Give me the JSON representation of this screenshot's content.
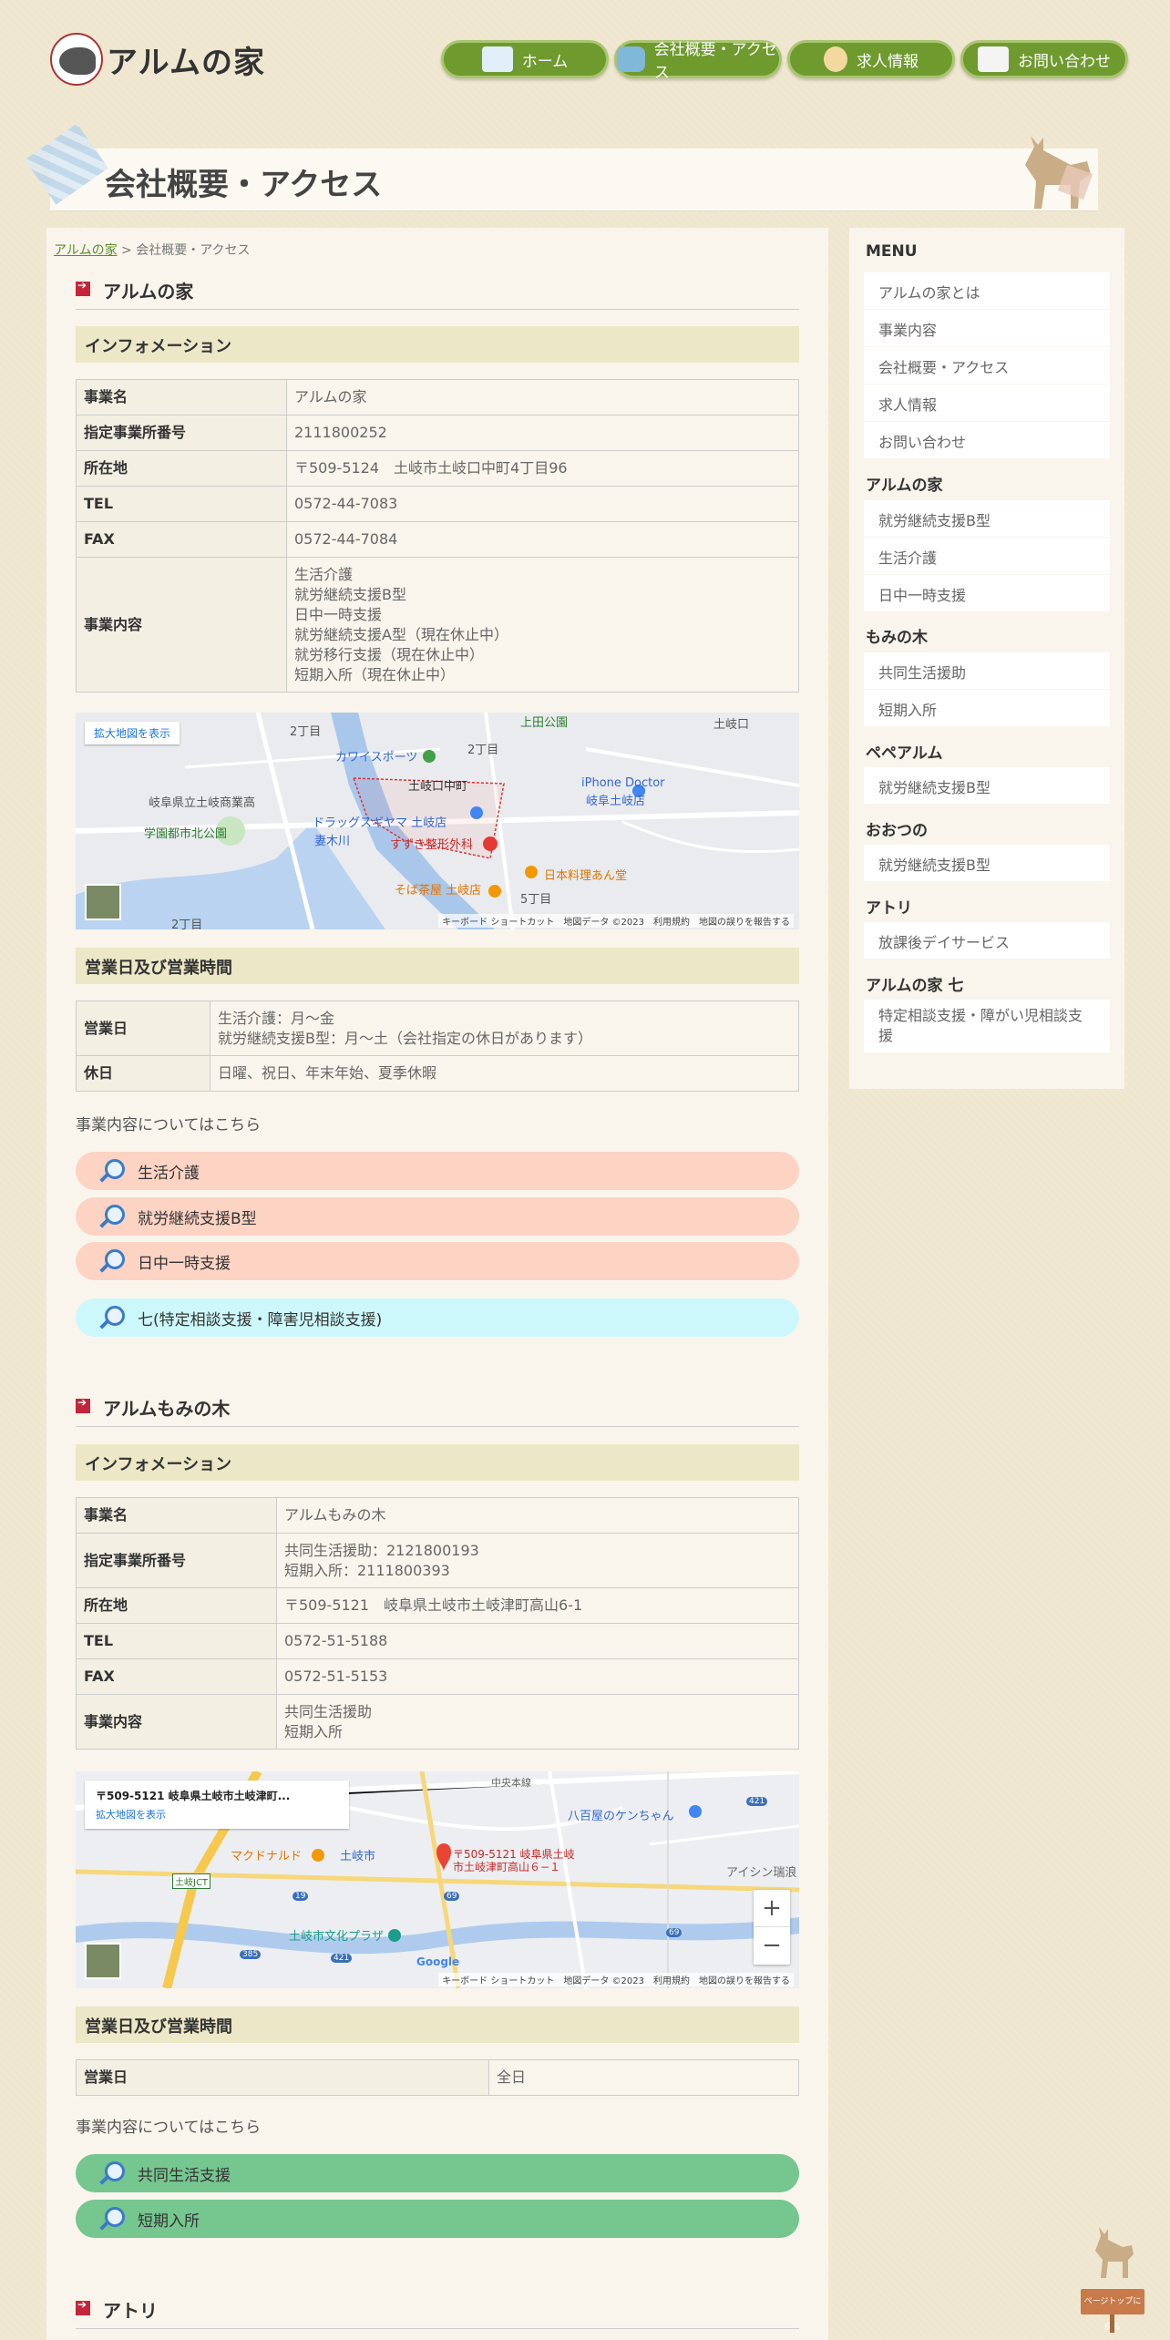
{
  "header": {
    "logo_text": "アルムの家",
    "nav": [
      {
        "label": "ホーム",
        "icon": "house-icon"
      },
      {
        "label": "会社概要・アクセス",
        "icon": "bus-icon"
      },
      {
        "label": "求人情報",
        "icon": "face-icon"
      },
      {
        "label": "お問い合わせ",
        "icon": "mail-icon"
      }
    ]
  },
  "page_title": "会社概要・アクセス",
  "breadcrumb": {
    "home": "アルムの家",
    "sep": ">",
    "current": "会社概要・アクセス"
  },
  "sections": {
    "arumu": {
      "title": "アルムの家",
      "info_title": "インフォメーション",
      "rows": [
        {
          "k": "事業名",
          "v": "アルムの家"
        },
        {
          "k": "指定事業所番号",
          "v": "2111800252"
        },
        {
          "k": "所在地",
          "v": "〒509-5124　土岐市土岐口中町4丁目96"
        },
        {
          "k": "TEL",
          "v": "0572-44-7083"
        },
        {
          "k": "FAX",
          "v": "0572-44-7084"
        },
        {
          "k": "事業内容",
          "v": "生活介護\n就労継続支援B型\n日中一時支援\n就労継続支援A型（現在休止中）\n就労移行支援（現在休止中）\n短期入所（現在休止中）"
        }
      ],
      "map": {
        "expand": "拡大地図を表示",
        "labels": [
          "2丁目",
          "上田公園",
          "2丁目",
          "土岐口",
          "カワイスポーツ",
          "岐阜県立土岐商業高",
          "土岐口中町",
          "iPhone Doctor",
          "岐阜土岐店",
          "学園都市北公園",
          "ドラッグスギヤマ 土岐店",
          "妻木川",
          "すずき整形外科",
          "日本料理あん堂",
          "そば茶屋 土岐店",
          "5丁目",
          "2丁目"
        ],
        "footer": "キーボード ショートカット　地図データ ©2023　利用規約　地図の誤りを報告する"
      },
      "hours_title": "営業日及び営業時間",
      "hours": [
        {
          "k": "営業日",
          "v": "生活介護：月〜金\n就労継続支援B型：月〜土（会社指定の休日があります）"
        },
        {
          "k": "休日",
          "v": "日曜、祝日、年末年始、夏季休暇"
        }
      ],
      "note": "事業内容についてはこちら",
      "links": [
        "生活介護",
        "就労継続支援B型",
        "日中一時支援"
      ],
      "link_seven": "七(特定相談支援・障害児相談支援)"
    },
    "momi": {
      "title": "アルムもみの木",
      "info_title": "インフォメーション",
      "rows": [
        {
          "k": "事業名",
          "v": "アルムもみの木"
        },
        {
          "k": "指定事業所番号",
          "v": "共同生活援助：2121800193\n短期入所：2111800393"
        },
        {
          "k": "所在地",
          "v": "〒509-5121　岐阜県土岐市土岐津町高山6-1"
        },
        {
          "k": "TEL",
          "v": "0572-51-5188"
        },
        {
          "k": "FAX",
          "v": "0572-51-5153"
        },
        {
          "k": "事業内容",
          "v": "共同生活援助\n短期入所"
        }
      ],
      "map": {
        "card_title": "〒509-5121 岐阜県土岐市土岐津町...",
        "expand": "拡大地図を表示",
        "labels": [
          "中央本線",
          "八百屋のケンちゃん",
          "マクドナルド",
          "土岐市",
          "〒509-5121 岐阜県土岐",
          "市土岐津町高山６−１",
          "土岐JCT",
          "アイシン瑞浪",
          "土岐市文化プラザ",
          "Google",
          "421",
          "19",
          "69",
          "385",
          "421",
          "69"
        ],
        "zoom_in": "+",
        "zoom_out": "−",
        "footer": "キーボード ショートカット　地図データ ©2023　利用規約　地図の誤りを報告する"
      },
      "hours_title": "営業日及び営業時間",
      "hours": [
        {
          "k": "営業日",
          "v": "全日"
        }
      ],
      "note": "事業内容についてはこちら",
      "links": [
        "共同生活支援",
        "短期入所"
      ]
    },
    "atori": {
      "title": "アトリ"
    }
  },
  "sidebar": {
    "menu_title": "MENU",
    "menu": [
      "アルムの家とは",
      "事業内容",
      "会社概要・アクセス",
      "求人情報",
      "お問い合わせ"
    ],
    "groups": [
      {
        "title": "アルムの家",
        "items": [
          "就労継続支援B型",
          "生活介護",
          "日中一時支援"
        ]
      },
      {
        "title": "もみの木",
        "items": [
          "共同生活援助",
          "短期入所"
        ]
      },
      {
        "title": "ペペアルム",
        "items": [
          "就労継続支援B型"
        ]
      },
      {
        "title": "おおつの",
        "items": [
          "就労継続支援B型"
        ]
      },
      {
        "title": "アトリ",
        "items": [
          "放課後デイサービス"
        ]
      },
      {
        "title": "アルムの家 七",
        "items": [
          "特定相談支援・障がい児相談支援"
        ]
      }
    ]
  },
  "totop": "ページトップに戻る",
  "colors": {
    "nav_green": "#6e9a2e",
    "accent_red": "#c4253b",
    "pink": "#fdd3c3",
    "cyan": "#ccf8fb",
    "green": "#75c68f"
  }
}
